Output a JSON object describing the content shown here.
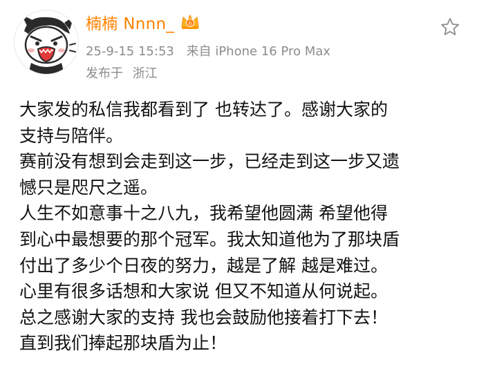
{
  "user": {
    "name": "楠楠 Nnnn_",
    "avatar_icon": "cartoon-cat-avatar",
    "badge_icon": "vip-crown-badge"
  },
  "meta": {
    "date": "25-9-15 15:53",
    "source": "来自 iPhone 16 Pro Max",
    "location_label": "发布于",
    "location": "浙江"
  },
  "actions": {
    "favorite_icon": "star-icon"
  },
  "post": {
    "lines": [
      "大家发的私信我都看到了 也转达了。感谢大家的",
      "支持与陪伴。",
      "赛前没有想到会走到这一步，已经走到这一步又遗",
      "憾只是咫尺之遥。",
      "人生不如意事十之八九，我希望他圆满 希望他得",
      "到心中最想要的那个冠军。我太知道他为了那块盾",
      "付出了多少个日夜的努力，越是了解 越是难过。",
      "心里有很多话想和大家说 但又不知道从何说起。",
      "总之感谢大家的支持 我也会鼓励他接着打下去！",
      "直到我们捧起那块盾为止！"
    ]
  },
  "colors": {
    "username": "#ff8200",
    "meta": "#8c8c8c",
    "text": "#111111"
  }
}
